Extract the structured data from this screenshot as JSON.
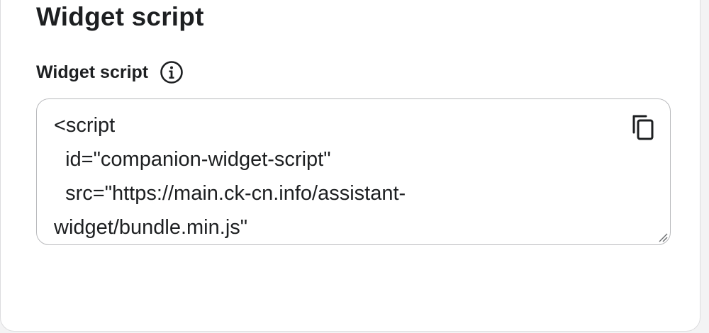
{
  "section": {
    "title": "Widget script"
  },
  "field": {
    "label": "Widget script",
    "info_icon": "info-circle-icon",
    "value": "<script\n  id=\"companion-widget-script\"\n  src=\"https://main.ck-cn.info/assistant-\nwidget/bundle.min.js\"",
    "copy_icon": "copy-icon"
  },
  "colors": {
    "text": "#1d1f21",
    "border": "#b9babd",
    "page_background": "#f3f3f4",
    "card_background": "#ffffff"
  }
}
